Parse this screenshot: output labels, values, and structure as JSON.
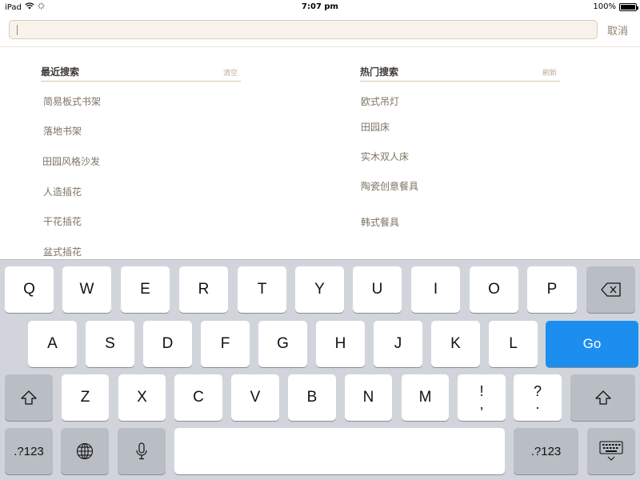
{
  "status_bar": {
    "device": "iPad",
    "time": "7:07 pm",
    "battery_percent": "100%",
    "battery_level": 1.0
  },
  "search": {
    "value": "",
    "placeholder": "",
    "cancel_label": "取消"
  },
  "recent": {
    "title": "最近搜索",
    "action": "清空",
    "items": [
      "简易板式书架",
      "落地书架",
      "田园风格沙发",
      "人造插花",
      "干花插花",
      "盆式插花"
    ]
  },
  "hot": {
    "title": "热门搜索",
    "action": "刷新",
    "items": [
      "欧式吊灯",
      "田园床",
      "实木双人床",
      "陶瓷创意餐具",
      "韩式餐具"
    ]
  },
  "keyboard": {
    "row1": [
      "Q",
      "W",
      "E",
      "R",
      "T",
      "Y",
      "U",
      "I",
      "O",
      "P"
    ],
    "row2": [
      "A",
      "S",
      "D",
      "F",
      "G",
      "H",
      "J",
      "K",
      "L"
    ],
    "row3": [
      "Z",
      "X",
      "C",
      "V",
      "B",
      "N",
      "M"
    ],
    "go_label": "Go",
    "numbers_label": ".?123",
    "punct1_top": "!",
    "punct1_bottom": ",",
    "punct2_top": "?",
    "punct2_bottom": ".",
    "icons": [
      "backspace-icon",
      "shift-icon",
      "globe-icon",
      "microphone-icon",
      "hide-keyboard-icon"
    ]
  },
  "colors": {
    "accent_go": "#1c8ef0",
    "keyboard_bg": "#d1d5db",
    "header_underline": "#d9c9a8"
  }
}
